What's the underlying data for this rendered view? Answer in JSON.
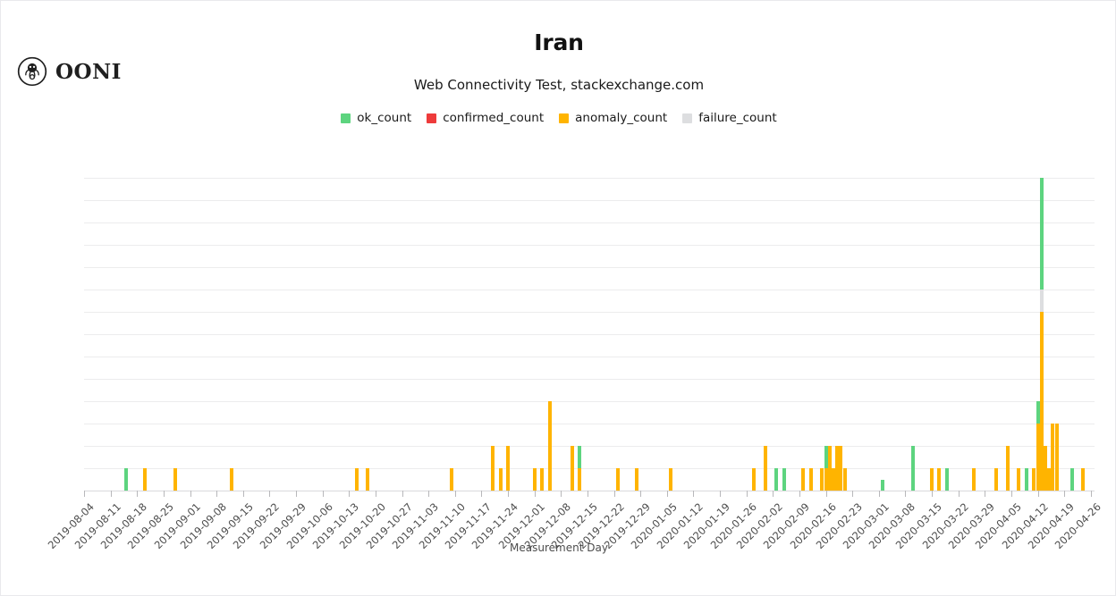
{
  "brand": {
    "name": "OONI",
    "icon": "ooni-octopus-logo"
  },
  "header": {
    "title": "Iran",
    "subtitle": "Web Connectivity Test, stackexchange.com"
  },
  "legend": [
    {
      "label": "ok_count",
      "color": "#5DD47F"
    },
    {
      "label": "confirmed_count",
      "color": "#EE3B3B"
    },
    {
      "label": "anomaly_count",
      "color": "#FFB400"
    },
    {
      "label": "failure_count",
      "color": "#DDDEE0"
    }
  ],
  "chart_data": {
    "type": "bar",
    "stacked": true,
    "title": "Iran",
    "subtitle": "Web Connectivity Test, stackexchange.com",
    "xlabel": "Measurement Day",
    "ylabel": "",
    "ylim": [
      0,
      28
    ],
    "yticks": [
      0,
      2,
      4,
      6,
      8,
      10,
      12,
      14,
      16,
      18,
      20,
      22,
      24,
      26,
      28
    ],
    "grid": true,
    "legend_position": "top-center",
    "x_start": "2019-08-04",
    "x_end": "2020-04-26",
    "xticks": [
      "2019-08-04",
      "2019-08-11",
      "2019-08-18",
      "2019-08-25",
      "2019-09-01",
      "2019-09-08",
      "2019-09-15",
      "2019-09-22",
      "2019-09-29",
      "2019-10-06",
      "2019-10-13",
      "2019-10-20",
      "2019-10-27",
      "2019-11-03",
      "2019-11-10",
      "2019-11-17",
      "2019-11-24",
      "2019-12-01",
      "2019-12-08",
      "2019-12-15",
      "2019-12-22",
      "2019-12-29",
      "2020-01-05",
      "2020-01-12",
      "2020-01-19",
      "2020-01-26",
      "2020-02-02",
      "2020-02-09",
      "2020-02-16",
      "2020-02-23",
      "2020-03-01",
      "2020-03-08",
      "2020-03-15",
      "2020-03-22",
      "2020-03-29",
      "2020-04-05",
      "2020-04-12",
      "2020-04-19",
      "2020-04-26"
    ],
    "series": [
      {
        "name": "ok_count",
        "color": "#5DD47F"
      },
      {
        "name": "confirmed_count",
        "color": "#EE3B3B"
      },
      {
        "name": "anomaly_count",
        "color": "#FFB400"
      },
      {
        "name": "failure_count",
        "color": "#DDDEE0"
      }
    ],
    "points": [
      {
        "day": "2019-08-15",
        "ok": 2,
        "confirmed": 0,
        "anomaly": 0,
        "failure": 0
      },
      {
        "day": "2019-08-20",
        "ok": 0,
        "confirmed": 0,
        "anomaly": 2,
        "failure": 0
      },
      {
        "day": "2019-08-28",
        "ok": 0,
        "confirmed": 0,
        "anomaly": 2,
        "failure": 0
      },
      {
        "day": "2019-09-12",
        "ok": 0,
        "confirmed": 0,
        "anomaly": 2,
        "failure": 0
      },
      {
        "day": "2019-10-15",
        "ok": 0,
        "confirmed": 0,
        "anomaly": 2,
        "failure": 0
      },
      {
        "day": "2019-10-18",
        "ok": 0,
        "confirmed": 0,
        "anomaly": 2,
        "failure": 0
      },
      {
        "day": "2019-11-09",
        "ok": 0,
        "confirmed": 0,
        "anomaly": 2,
        "failure": 0
      },
      {
        "day": "2019-11-20",
        "ok": 0,
        "confirmed": 0,
        "anomaly": 4,
        "failure": 0
      },
      {
        "day": "2019-11-22",
        "ok": 0,
        "confirmed": 0,
        "anomaly": 2,
        "failure": 0
      },
      {
        "day": "2019-11-24",
        "ok": 0,
        "confirmed": 0,
        "anomaly": 4,
        "failure": 0
      },
      {
        "day": "2019-12-01",
        "ok": 0,
        "confirmed": 0,
        "anomaly": 2,
        "failure": 0
      },
      {
        "day": "2019-12-03",
        "ok": 0,
        "confirmed": 0,
        "anomaly": 2,
        "failure": 0
      },
      {
        "day": "2019-12-05",
        "ok": 0,
        "confirmed": 0,
        "anomaly": 8,
        "failure": 0
      },
      {
        "day": "2019-12-11",
        "ok": 0,
        "confirmed": 0,
        "anomaly": 4,
        "failure": 0
      },
      {
        "day": "2019-12-13",
        "ok": 2,
        "confirmed": 0,
        "anomaly": 2,
        "failure": 0
      },
      {
        "day": "2019-12-23",
        "ok": 0,
        "confirmed": 0,
        "anomaly": 2,
        "failure": 0
      },
      {
        "day": "2019-12-28",
        "ok": 0,
        "confirmed": 0,
        "anomaly": 2,
        "failure": 0
      },
      {
        "day": "2020-01-06",
        "ok": 0,
        "confirmed": 0,
        "anomaly": 2,
        "failure": 0
      },
      {
        "day": "2020-01-28",
        "ok": 0,
        "confirmed": 0,
        "anomaly": 2,
        "failure": 0
      },
      {
        "day": "2020-01-31",
        "ok": 0,
        "confirmed": 0,
        "anomaly": 4,
        "failure": 0
      },
      {
        "day": "2020-02-03",
        "ok": 2,
        "confirmed": 0,
        "anomaly": 0,
        "failure": 0
      },
      {
        "day": "2020-02-05",
        "ok": 2,
        "confirmed": 0,
        "anomaly": 0,
        "failure": 0
      },
      {
        "day": "2020-02-10",
        "ok": 0,
        "confirmed": 0,
        "anomaly": 2,
        "failure": 0
      },
      {
        "day": "2020-02-12",
        "ok": 0,
        "confirmed": 0,
        "anomaly": 2,
        "failure": 0
      },
      {
        "day": "2020-02-15",
        "ok": 0,
        "confirmed": 0,
        "anomaly": 2,
        "failure": 0
      },
      {
        "day": "2020-02-16",
        "ok": 2,
        "confirmed": 0,
        "anomaly": 2,
        "failure": 0
      },
      {
        "day": "2020-02-17",
        "ok": 0,
        "confirmed": 0,
        "anomaly": 4,
        "failure": 0
      },
      {
        "day": "2020-02-18",
        "ok": 0,
        "confirmed": 0,
        "anomaly": 2,
        "failure": 0
      },
      {
        "day": "2020-02-19",
        "ok": 0,
        "confirmed": 0,
        "anomaly": 4,
        "failure": 0
      },
      {
        "day": "2020-02-20",
        "ok": 0,
        "confirmed": 0,
        "anomaly": 4,
        "failure": 0
      },
      {
        "day": "2020-02-21",
        "ok": 0,
        "confirmed": 0,
        "anomaly": 2,
        "failure": 0
      },
      {
        "day": "2020-03-02",
        "ok": 1,
        "confirmed": 0,
        "anomaly": 0,
        "failure": 0
      },
      {
        "day": "2020-03-10",
        "ok": 4,
        "confirmed": 0,
        "anomaly": 0,
        "failure": 0
      },
      {
        "day": "2020-03-15",
        "ok": 0,
        "confirmed": 0,
        "anomaly": 2,
        "failure": 0
      },
      {
        "day": "2020-03-17",
        "ok": 0,
        "confirmed": 0,
        "anomaly": 2,
        "failure": 0
      },
      {
        "day": "2020-03-19",
        "ok": 2,
        "confirmed": 0,
        "anomaly": 0,
        "failure": 0
      },
      {
        "day": "2020-03-26",
        "ok": 0,
        "confirmed": 0,
        "anomaly": 2,
        "failure": 0
      },
      {
        "day": "2020-04-01",
        "ok": 0,
        "confirmed": 0,
        "anomaly": 2,
        "failure": 0
      },
      {
        "day": "2020-04-04",
        "ok": 0,
        "confirmed": 0,
        "anomaly": 4,
        "failure": 0
      },
      {
        "day": "2020-04-07",
        "ok": 0,
        "confirmed": 0,
        "anomaly": 2,
        "failure": 0
      },
      {
        "day": "2020-04-09",
        "ok": 2,
        "confirmed": 0,
        "anomaly": 0,
        "failure": 0
      },
      {
        "day": "2020-04-11",
        "ok": 0,
        "confirmed": 0,
        "anomaly": 2,
        "failure": 0
      },
      {
        "day": "2020-04-12",
        "ok": 2,
        "confirmed": 0,
        "anomaly": 6,
        "failure": 0
      },
      {
        "day": "2020-04-13",
        "ok": 10,
        "confirmed": 0,
        "anomaly": 16,
        "failure": 2
      },
      {
        "day": "2020-04-14",
        "ok": 0,
        "confirmed": 0,
        "anomaly": 4,
        "failure": 0
      },
      {
        "day": "2020-04-15",
        "ok": 0,
        "confirmed": 0,
        "anomaly": 2,
        "failure": 0
      },
      {
        "day": "2020-04-16",
        "ok": 0,
        "confirmed": 0,
        "anomaly": 6,
        "failure": 0
      },
      {
        "day": "2020-04-17",
        "ok": 0,
        "confirmed": 0,
        "anomaly": 6,
        "failure": 0
      },
      {
        "day": "2020-04-21",
        "ok": 2,
        "confirmed": 0,
        "anomaly": 0,
        "failure": 0
      },
      {
        "day": "2020-04-24",
        "ok": 0,
        "confirmed": 0,
        "anomaly": 2,
        "failure": 0
      }
    ]
  }
}
